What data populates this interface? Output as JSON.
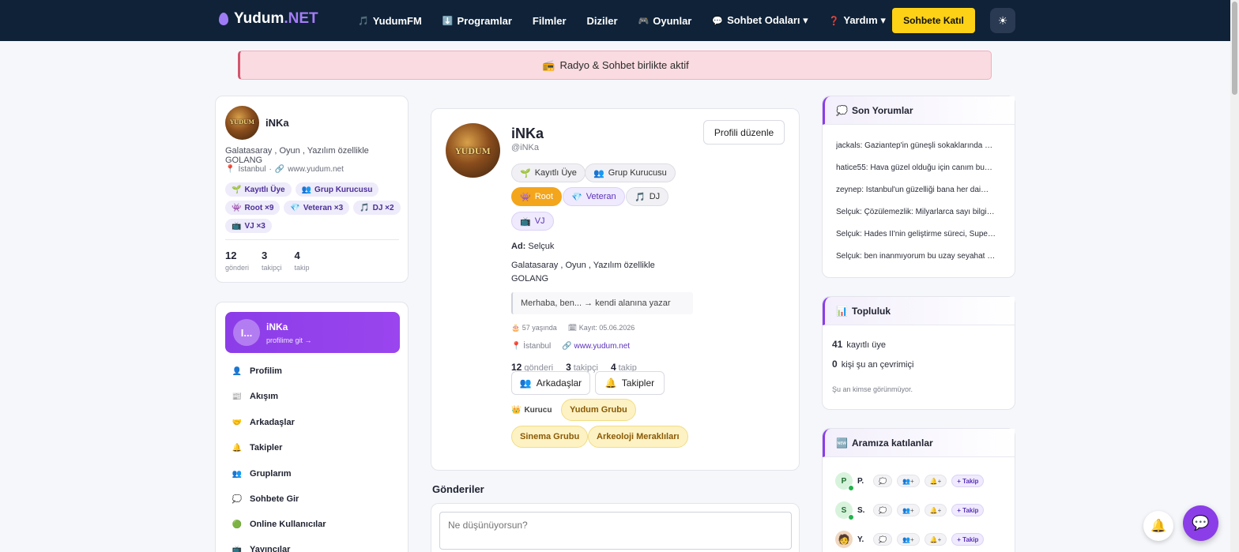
{
  "nav": {
    "logo_main": "Yudum",
    "logo_suffix": ".NET",
    "links": [
      {
        "icon": "🎵",
        "label": "YudumFM"
      },
      {
        "icon": "⬇️",
        "label": "Programlar"
      },
      {
        "icon": "",
        "label": "Filmler"
      },
      {
        "icon": "",
        "label": "Diziler"
      },
      {
        "icon": "🎮",
        "label": "Oyunlar"
      },
      {
        "icon": "💬",
        "label": "Sohbet Odaları ▾"
      },
      {
        "icon": "❓",
        "label": "Yardım ▾"
      }
    ],
    "join_label": "Sohbete Katıl",
    "theme_icon": "☀"
  },
  "banner": {
    "icon": "📻",
    "text": "Radyo & Sohbet birlikte aktif"
  },
  "left_profile": {
    "avatar_text": "YUDUM",
    "name": "iNKa",
    "bio": "Galatasaray , Oyun , Yazılım özellikle GOLANG",
    "location": "İstanbul",
    "website": "www.yudum.net",
    "tags": [
      {
        "icon": "🌱",
        "label": "Kayıtlı Üye"
      },
      {
        "icon": "👥",
        "label": "Grup Kurucusu"
      },
      {
        "icon": "👾",
        "label": "Root ×9"
      },
      {
        "icon": "💎",
        "label": "Veteran ×3"
      },
      {
        "icon": "🎵",
        "label": "DJ ×2"
      },
      {
        "icon": "📺",
        "label": "VJ ×3"
      }
    ],
    "stats": [
      {
        "value": "12",
        "label": "gönderi"
      },
      {
        "value": "3",
        "label": "takipçi"
      },
      {
        "value": "4",
        "label": "takip"
      }
    ]
  },
  "menu": {
    "head_initials": "I...",
    "head_name": "iNKa",
    "head_sub": "profilime git →",
    "items": [
      {
        "icon": "👤",
        "label": "Profilim"
      },
      {
        "icon": "📰",
        "label": "Akışım"
      },
      {
        "icon": "🤝",
        "label": "Arkadaşlar"
      },
      {
        "icon": "🔔",
        "label": "Takipler"
      },
      {
        "icon": "👥",
        "label": "Gruplarım"
      },
      {
        "icon": "💭",
        "label": "Sohbete Gir"
      },
      {
        "icon": "🟢",
        "label": "Online Kullanıcılar"
      },
      {
        "icon": "📺",
        "label": "Yayıncılar"
      }
    ]
  },
  "profile": {
    "avatar_text": "YUDUM",
    "name": "iNKa",
    "handle": "@iNKa",
    "edit_label": "Profili düzenle",
    "badges": [
      {
        "icon": "🌱",
        "label": "Kayıtlı Üye"
      },
      {
        "icon": "👥",
        "label": "Grup Kurucusu"
      },
      {
        "icon": "👾",
        "label": "Root"
      },
      {
        "icon": "💎",
        "label": "Veteran"
      },
      {
        "icon": "🎵",
        "label": "DJ"
      },
      {
        "icon": "📺",
        "label": "VJ"
      }
    ],
    "name_label": "Ad:",
    "real_name": "Selçuk",
    "bio_line1": "Galatasaray , Oyun , Yazılım özellikle",
    "bio_line2": "GOLANG",
    "quote": "Merhaba, ben... → kendi alanına yazar",
    "age": "57 yaşında",
    "registered": "Kayıt: 05.06.2026",
    "location": "İstanbul",
    "website": "www.yudum.net",
    "stats": [
      {
        "value": "12",
        "label": "gönderi"
      },
      {
        "value": "3",
        "label": "takipçi"
      },
      {
        "value": "4",
        "label": "takip"
      }
    ],
    "friends_label": "Arkadaşlar",
    "followers_label": "Takipler",
    "founder_label": "Kurucu",
    "groups": [
      "Yudum Grubu",
      "Sinema Grubu",
      "Arkeoloji Meraklıları"
    ]
  },
  "posts": {
    "title": "Gönderiler",
    "placeholder": "Ne düşünüyorsun?"
  },
  "recent_comments": {
    "title": "Son Yorumlar",
    "items": [
      "jackals: Gaziantep'in güneşli sokaklarında …",
      "hatice55: Hava güzel olduğu için canım bu…",
      "zeynep: İstanbul'un güzelliği bana her dai…",
      "Selçuk: Çözülemezlik: Milyarlarca sayı bilgi…",
      "Selçuk: Hades II'nin geliştirme süreci, Supe…",
      "Selçuk: ben inanmıyorum bu uzay seyahat …"
    ]
  },
  "community": {
    "title": "Topluluk",
    "members_count": "41",
    "members_label": "kayıtlı üye",
    "online_count": "0",
    "online_label": "kişi şu an çevrimiçi",
    "empty_text": "Şu an kimse görünmüyor."
  },
  "new_members": {
    "title": "Aramıza katılanlar",
    "users": [
      {
        "initial": "P",
        "name": "P."
      },
      {
        "initial": "S",
        "name": "S."
      },
      {
        "initial": "",
        "name": "Y."
      }
    ],
    "follow_label": "+ Takip",
    "add_label": "+"
  }
}
